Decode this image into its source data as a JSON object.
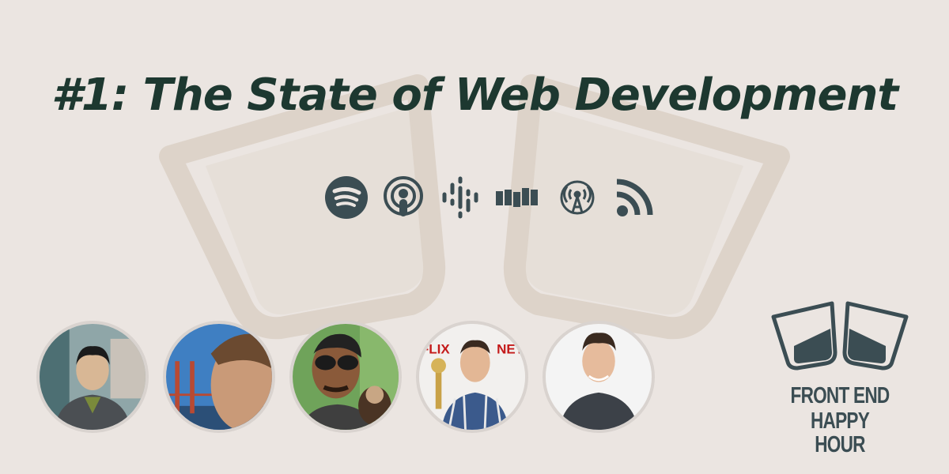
{
  "episode": {
    "title": "#1: The State of Web Development"
  },
  "platforms": [
    {
      "name": "Spotify",
      "icon": "spotify-icon"
    },
    {
      "name": "Apple Podcasts",
      "icon": "apple-podcasts-icon"
    },
    {
      "name": "Google Podcasts",
      "icon": "google-podcasts-icon"
    },
    {
      "name": "Stitcher",
      "icon": "stitcher-icon"
    },
    {
      "name": "Overcast",
      "icon": "overcast-icon"
    },
    {
      "name": "RSS",
      "icon": "rss-icon"
    }
  ],
  "hosts_count": 5,
  "brand": {
    "line1": "FRONT END",
    "line2": "HAPPY HOUR",
    "colors": {
      "title": "#1d3830",
      "icon": "#3b4d53",
      "background": "#ebe5e1",
      "watermark": "#ddd3c9"
    }
  }
}
